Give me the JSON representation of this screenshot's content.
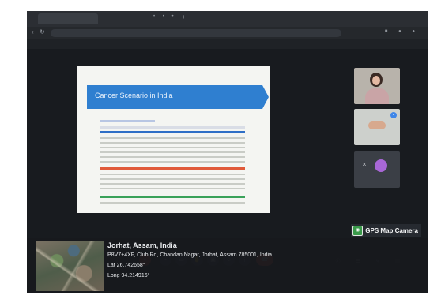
{
  "browser": {
    "tabs": [
      "",
      ""
    ],
    "url": "",
    "meeting_title": ""
  },
  "slide": {
    "title": "Cancer Scenario in India"
  },
  "participants": [
    {
      "name": ""
    },
    {
      "name": ""
    },
    {
      "name": "",
      "avatar_letter": ""
    }
  ],
  "self_label": "",
  "controls": {
    "accent": "#ea4e35"
  },
  "gps": {
    "brand": "GPS Map Camera",
    "city": "Jorhat, Assam, India",
    "address": "P8V7+4XF, Club Rd, Chandan Nagar, Jorhat, Assam 785001, India",
    "lat": "Lat 26.742658°",
    "long": "Long 94.214916°"
  },
  "colors": {
    "slide_banner": "#2f7fd0",
    "gps_logo": "#3a9a4a"
  }
}
